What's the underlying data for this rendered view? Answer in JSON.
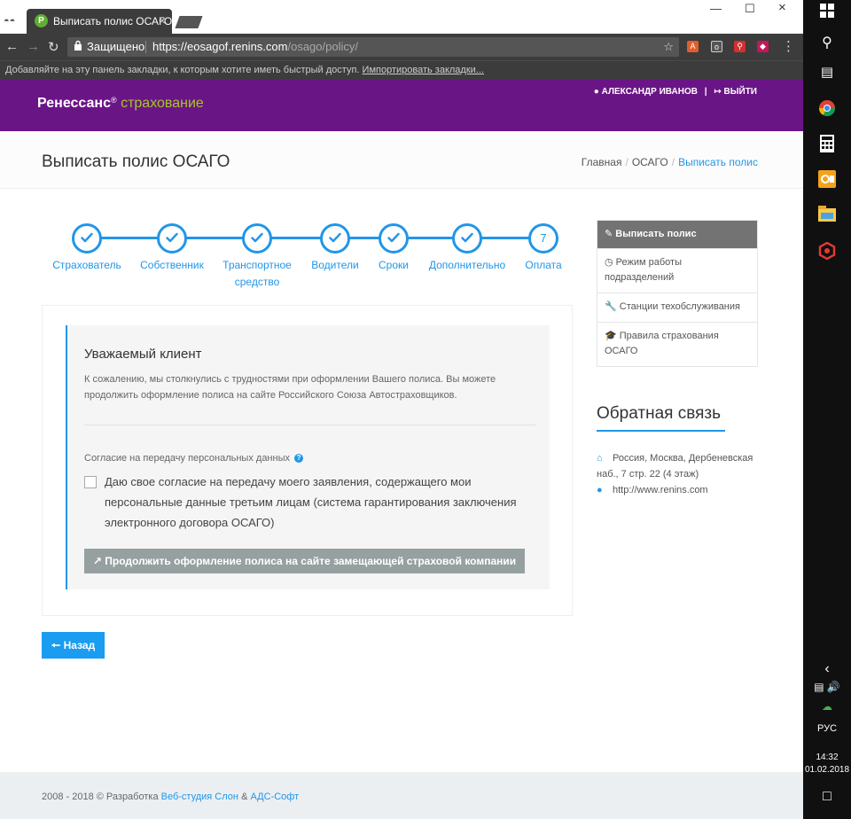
{
  "browser": {
    "tab_title": "Выписать полис ОСАГО",
    "secure_label": "Защищено",
    "url_host": "https://eosagof.renins.com",
    "url_path": "/osago/policy/",
    "bookmarks_bar_text": "Добавляйте на эту панель закладки, к которым хотите иметь быстрый доступ.",
    "import_bookmarks": "Импортировать закладки..."
  },
  "site_header": {
    "logo_main": "Ренессанс",
    "logo_reg": "®",
    "logo_sub": "страхование",
    "user_name": "АЛЕКСАНДР ИВАНОВ",
    "separator": "|",
    "logout": "ВЫЙТИ"
  },
  "page": {
    "title": "Выписать полис ОСАГО",
    "breadcrumbs": [
      "Главная",
      "ОСАГО",
      "Выписать полис"
    ]
  },
  "steps": [
    {
      "label": "Страхователь",
      "done": true
    },
    {
      "label": "Собственник",
      "done": true
    },
    {
      "label": "Транспортное средство",
      "done": true
    },
    {
      "label": "Водители",
      "done": true
    },
    {
      "label": "Сроки",
      "done": true
    },
    {
      "label": "Дополнительно",
      "done": true
    },
    {
      "label": "Оплата",
      "done": false,
      "number": "7"
    }
  ],
  "notice": {
    "title": "Уважаемый клиент",
    "text": "К сожалению, мы столкнулись с трудностями при оформлении Вашего полиса. Вы можете продолжить оформление полиса на сайте Российского Союза Автостраховщиков.",
    "consent_label": "Согласие на передачу персональных данных",
    "consent_checkbox_text": "Даю свое согласие на передачу моего заявления, содержащего мои персональные данные третьим лицам (система гарантирования заключения электронного договора ОСАГО)",
    "consent_checked": false,
    "continue_button": "Продолжить оформление полиса на сайте замещающей страховой компании"
  },
  "back_button": "Назад",
  "sidebar": {
    "header": "Выписать полис",
    "items": [
      {
        "label": "Режим работы подразделений",
        "icon": "clock-icon"
      },
      {
        "label": "Станции техобслуживания",
        "icon": "wrench-icon"
      },
      {
        "label": "Правила страхования ОСАГО",
        "icon": "graduation-cap-icon"
      }
    ]
  },
  "feedback": {
    "title": "Обратная связь",
    "address": "Россия, Москва, Дербеневская наб., 7 стр. 22 (4 этаж)",
    "website": "http://www.renins.com"
  },
  "footer": {
    "years": "2008 - 2018 © Разработка",
    "studio": "Веб-студия Слон",
    "and": "&",
    "partner": "АДС-Софт"
  },
  "taskbar": {
    "language": "РУС",
    "time": "14:32",
    "date": "01.02.2018"
  },
  "colors": {
    "brand_purple": "#6a1586",
    "accent_blue": "#2196e8",
    "logo_green": "#a4c81f"
  }
}
